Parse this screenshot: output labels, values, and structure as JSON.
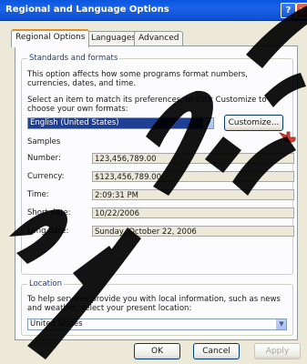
{
  "window": {
    "title": "Regional and Language Options",
    "help_label": "?",
    "close_label": "x"
  },
  "tabs": [
    {
      "label": "Regional Options",
      "active": true
    },
    {
      "label": "Languages",
      "active": false
    },
    {
      "label": "Advanced",
      "active": false
    }
  ],
  "standards": {
    "group_title": "Standards and formats",
    "description": "This option affects how some programs format numbers, currencies, dates, and time.",
    "instruction": "Select an item to match its preferences, or click Customize to choose your own formats:",
    "selected_format": "English (United States)",
    "customize_label": "Customize..."
  },
  "samples": {
    "title": "Samples",
    "rows": [
      {
        "label": "Number:",
        "value": "123,456,789.00"
      },
      {
        "label": "Currency:",
        "value": "$123,456,789.00"
      },
      {
        "label": "Time:",
        "value": "2:09:31 PM"
      },
      {
        "label": "Short date:",
        "value": "10/22/2006"
      },
      {
        "label": "Long date:",
        "value": "Sunday, October 22, 2006"
      }
    ]
  },
  "location": {
    "group_title": "Location",
    "description": "To help services provide you with local information, such as news and weather, select your present location:",
    "selected": "United States"
  },
  "footer": {
    "ok_label": "OK",
    "cancel_label": "Cancel",
    "apply_label": "Apply"
  },
  "icons": {
    "dropdown_arrow": "chevron-down-icon",
    "pointer": "hand-cursor-icon"
  },
  "colors": {
    "titlebar": "#0a56e0",
    "selection": "#1f3f94",
    "tab_accent": "#e68b2c",
    "client_bg": "#ece9d8"
  }
}
